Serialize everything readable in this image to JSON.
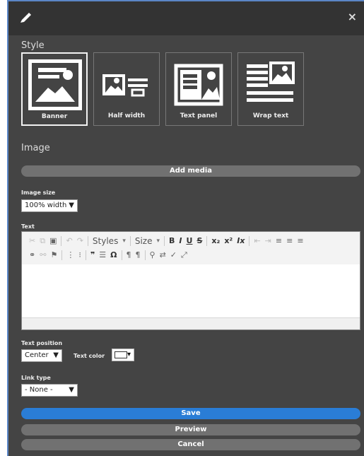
{
  "dialog": {
    "close_label": "×"
  },
  "style_section": {
    "title": "Style",
    "options": [
      {
        "label": "Banner"
      },
      {
        "label": "Half width"
      },
      {
        "label": "Text panel"
      },
      {
        "label": "Wrap text"
      }
    ]
  },
  "image_section": {
    "title": "Image",
    "add_media_label": "Add media",
    "image_size_label": "Image size",
    "image_size_value": "100% width"
  },
  "text_section": {
    "label": "Text",
    "toolbar": {
      "styles_label": "Styles",
      "size_label": "Size"
    }
  },
  "text_position": {
    "label": "Text position",
    "value": "Center"
  },
  "text_color": {
    "label": "Text color",
    "swatch_color": "#ffffff"
  },
  "link_type": {
    "label": "Link type",
    "value": "- None -"
  },
  "actions": {
    "save_label": "Save",
    "preview_label": "Preview",
    "cancel_label": "Cancel"
  },
  "colors": {
    "primary": "#2a7dd6",
    "panel": "#444444",
    "topbar": "#333333"
  }
}
